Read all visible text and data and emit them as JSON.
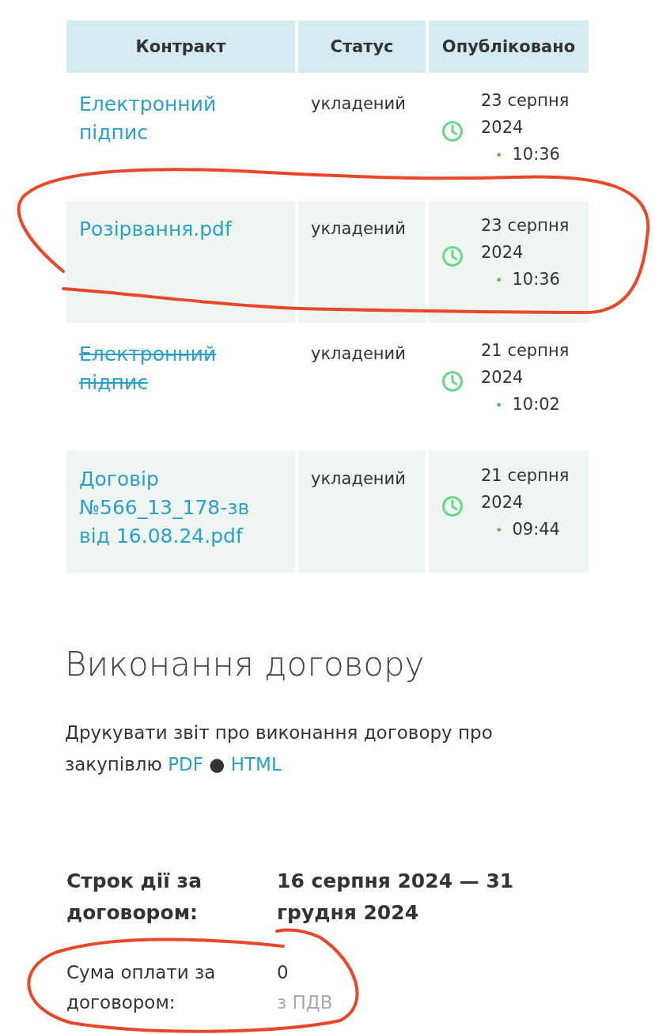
{
  "table": {
    "columns": [
      "Контракт",
      "Статус",
      "Опубліковано"
    ],
    "rows": [
      {
        "name": "Електронний підпис",
        "cancelled": false,
        "status": "укладений",
        "date": "23 серпня 2024",
        "bullet": "•",
        "time": "10:36"
      },
      {
        "name": "Розірвання.pdf",
        "cancelled": false,
        "status": "укладений",
        "date": "23 серпня 2024",
        "bullet": "•",
        "time": "10:36"
      },
      {
        "name": "Електронний підпис",
        "cancelled": true,
        "status": "укладений",
        "date": "21 серпня 2024",
        "bullet": "•",
        "time": "10:02"
      },
      {
        "name": "Договір №566_13_178-зв від 16.08.24.pdf",
        "cancelled": false,
        "status": "укладений",
        "date": "21 серпня 2024",
        "bullet": "•",
        "time": "09:44"
      }
    ]
  },
  "execution": {
    "title": "Виконання договору",
    "text": "Друкувати звіт про виконання договору про закупівлю",
    "links": [
      "PDF",
      "HTML"
    ],
    "separator": "●"
  },
  "terms": [
    {
      "kind": "bold",
      "label": "Строк дії за договором:",
      "value": "16 серпня 2024 — 31 грудня 2024"
    },
    {
      "kind": "plain",
      "label": "Сума оплати за договором:",
      "value": "0",
      "note": "з ПДВ"
    }
  ]
}
